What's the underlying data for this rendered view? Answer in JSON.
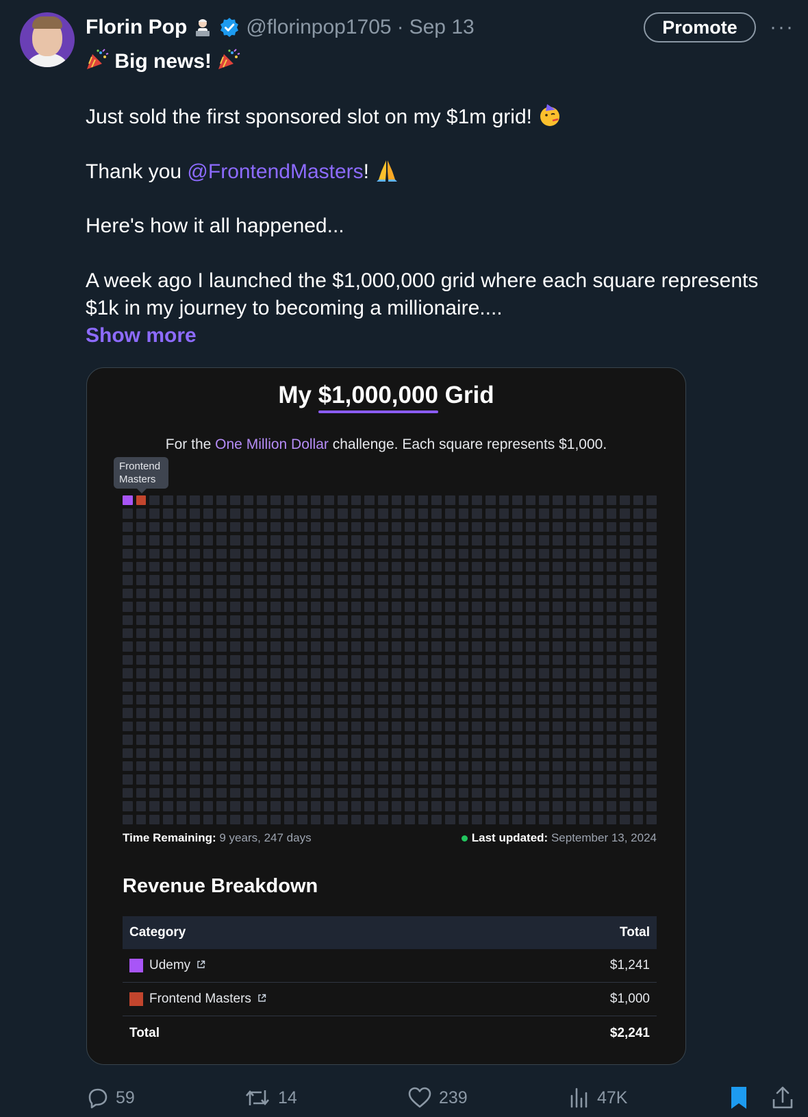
{
  "author": {
    "name": "Florin Pop",
    "handle": "@florinpop1705",
    "separator": "·",
    "date": "Sep 13"
  },
  "header": {
    "promote_label": "Promote",
    "more_label": "···"
  },
  "tweet": {
    "line1": "Big news!",
    "line2": "Just sold the first sponsored slot on my $1m grid!",
    "line3_prefix": "Thank you ",
    "line3_mention": "@FrontendMasters",
    "line3_suffix": "!",
    "line4": "Here's how it all happened...",
    "line5a": "A week ago I launched the $1,000,000 grid where each square represents",
    "line5b": "$1k in my journey to becoming a millionaire....",
    "show_more": "Show more"
  },
  "card": {
    "title_prefix": "My ",
    "title_money": "$1,000,000",
    "title_suffix": " Grid",
    "sub_prefix": "For the ",
    "sub_highlight": "One Million Dollar",
    "sub_suffix": " challenge. Each square represents $1,000.",
    "tooltip": "Frontend Masters",
    "grid": {
      "columns": 40,
      "rows": 25,
      "filled": [
        {
          "index": 0,
          "color": "#a855f7"
        },
        {
          "index": 1,
          "color": "#c2452d"
        }
      ],
      "empty_color": "#272a33"
    },
    "time_label": "Time Remaining:",
    "time_value": " 9 years, 247 days",
    "updated_label": "Last updated:",
    "updated_value": " September 13, 2024",
    "revenue_title": "Revenue Breakdown",
    "table": {
      "col_category": "Category",
      "col_total": "Total",
      "rows": [
        {
          "category": "Udemy",
          "total": "$1,241",
          "color": "#a855f7"
        },
        {
          "category": "Frontend Masters",
          "total": "$1,000",
          "color": "#c2452d"
        }
      ],
      "total_label": "Total",
      "total_value": "$2,241"
    }
  },
  "actions": {
    "replies": "59",
    "reposts": "14",
    "likes": "239",
    "views": "47K"
  },
  "colors": {
    "background": "#15202b",
    "accent": "#8d6bff",
    "verified": "#1d9bf0",
    "bookmark": "#1d9bf0"
  }
}
